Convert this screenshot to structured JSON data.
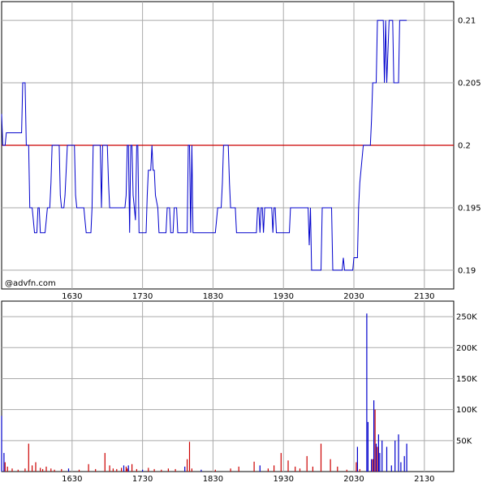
{
  "watermark": "@advfn.com",
  "colors": {
    "price": "#0000cc",
    "reference": "#cc0000",
    "volume_up": "#cc0000",
    "volume_down": "#0000cc",
    "grid": "#aaaaaa",
    "frame": "#000000"
  },
  "chart_data": [
    {
      "type": "line",
      "title": "",
      "xlabel": "",
      "ylabel": "",
      "x_ticks": [
        "1630",
        "1730",
        "1830",
        "1930",
        "2030",
        "2130"
      ],
      "y_ticks": [
        "0.19",
        "0.195",
        "0.2",
        "0.205",
        "0.21"
      ],
      "xlim": [
        "15:30",
        "21:55"
      ],
      "ylim": [
        0.1885,
        0.2115
      ],
      "grid": true,
      "reference_line": 0.2,
      "series": [
        {
          "points": [
            [
              "15:30",
              0.2025
            ],
            [
              "15:31",
              0.2
            ],
            [
              "15:33",
              0.2
            ],
            [
              "15:34",
              0.201
            ],
            [
              "15:40",
              0.201
            ],
            [
              "15:41",
              0.201
            ],
            [
              "15:47",
              0.201
            ],
            [
              "15:48",
              0.205
            ],
            [
              "15:50",
              0.205
            ],
            [
              "15:51",
              0.2
            ],
            [
              "15:53",
              0.2
            ],
            [
              "15:54",
              0.195
            ],
            [
              "15:56",
              0.195
            ],
            [
              "15:57",
              0.194
            ],
            [
              "15:58",
              0.193
            ],
            [
              "16:00",
              0.193
            ],
            [
              "16:01",
              0.195
            ],
            [
              "16:02",
              0.195
            ],
            [
              "16:03",
              0.193
            ],
            [
              "16:07",
              0.193
            ],
            [
              "16:08",
              0.194
            ],
            [
              "16:09",
              0.195
            ],
            [
              "16:11",
              0.195
            ],
            [
              "16:12",
              0.197
            ],
            [
              "16:13",
              0.2
            ],
            [
              "16:19",
              0.2
            ],
            [
              "16:20",
              0.196
            ],
            [
              "16:21",
              0.195
            ],
            [
              "16:23",
              0.195
            ],
            [
              "16:24",
              0.196
            ],
            [
              "16:26",
              0.2
            ],
            [
              "16:32",
              0.2
            ],
            [
              "16:33",
              0.196
            ],
            [
              "16:34",
              0.195
            ],
            [
              "16:40",
              0.195
            ],
            [
              "16:41",
              0.194
            ],
            [
              "16:42",
              0.193
            ],
            [
              "16:46",
              0.193
            ],
            [
              "16:47",
              0.195
            ],
            [
              "16:48",
              0.2
            ],
            [
              "16:54",
              0.2
            ],
            [
              "16:55",
              0.195
            ],
            [
              "16:56",
              0.2
            ],
            [
              "17:00",
              0.2
            ],
            [
              "17:01",
              0.197
            ],
            [
              "17:02",
              0.195
            ],
            [
              "17:15",
              0.195
            ],
            [
              "17:16",
              0.196
            ],
            [
              "17:17",
              0.2
            ],
            [
              "17:18",
              0.2
            ],
            [
              "17:19",
              0.193
            ],
            [
              "17:20",
              0.2
            ],
            [
              "17:21",
              0.2
            ],
            [
              "17:22",
              0.196
            ],
            [
              "17:23",
              0.195
            ],
            [
              "17:24",
              0.194
            ],
            [
              "17:25",
              0.2
            ],
            [
              "17:26",
              0.2
            ],
            [
              "17:27",
              0.193
            ],
            [
              "17:33",
              0.193
            ],
            [
              "17:34",
              0.196
            ],
            [
              "17:35",
              0.198
            ],
            [
              "17:37",
              0.198
            ],
            [
              "17:38",
              0.2
            ],
            [
              "17:39",
              0.198
            ],
            [
              "17:40",
              0.198
            ],
            [
              "17:41",
              0.196
            ],
            [
              "17:43",
              0.195
            ],
            [
              "17:44",
              0.193
            ],
            [
              "17:50",
              0.193
            ],
            [
              "17:51",
              0.195
            ],
            [
              "17:53",
              0.195
            ],
            [
              "17:54",
              0.193
            ],
            [
              "17:56",
              0.193
            ],
            [
              "17:57",
              0.195
            ],
            [
              "17:59",
              0.195
            ],
            [
              "18:00",
              0.193
            ],
            [
              "18:08",
              0.193
            ],
            [
              "18:09",
              0.2
            ],
            [
              "18:10",
              0.2
            ],
            [
              "18:11",
              0.193
            ],
            [
              "18:12",
              0.2
            ],
            [
              "18:13",
              0.193
            ],
            [
              "18:14",
              0.193
            ],
            [
              "18:15",
              0.193
            ],
            [
              "18:32",
              0.193
            ],
            [
              "18:33",
              0.194
            ],
            [
              "18:34",
              0.195
            ],
            [
              "18:37",
              0.195
            ],
            [
              "18:38",
              0.197
            ],
            [
              "18:39",
              0.2
            ],
            [
              "18:43",
              0.2
            ],
            [
              "18:44",
              0.197
            ],
            [
              "18:45",
              0.195
            ],
            [
              "18:49",
              0.195
            ],
            [
              "18:50",
              0.193
            ],
            [
              "18:53",
              0.193
            ],
            [
              "18:54",
              0.193
            ],
            [
              "19:07",
              0.193
            ],
            [
              "19:08",
              0.195
            ],
            [
              "19:09",
              0.195
            ],
            [
              "19:10",
              0.193
            ],
            [
              "19:11",
              0.195
            ],
            [
              "19:12",
              0.195
            ],
            [
              "19:13",
              0.193
            ],
            [
              "19:14",
              0.195
            ],
            [
              "19:20",
              0.195
            ],
            [
              "19:21",
              0.193
            ],
            [
              "19:22",
              0.195
            ],
            [
              "19:23",
              0.195
            ],
            [
              "19:24",
              0.193
            ],
            [
              "19:35",
              0.193
            ],
            [
              "19:36",
              0.195
            ],
            [
              "19:51",
              0.195
            ],
            [
              "19:52",
              0.192
            ],
            [
              "19:53",
              0.195
            ],
            [
              "19:54",
              0.19
            ],
            [
              "20:02",
              0.19
            ],
            [
              "20:03",
              0.195
            ],
            [
              "20:11",
              0.195
            ],
            [
              "20:12",
              0.19
            ],
            [
              "20:20",
              0.19
            ],
            [
              "20:21",
              0.191
            ],
            [
              "20:22",
              0.19
            ],
            [
              "20:29",
              0.19
            ],
            [
              "20:30",
              0.191
            ],
            [
              "20:33",
              0.191
            ],
            [
              "20:34",
              0.195
            ],
            [
              "20:35",
              0.197
            ],
            [
              "20:38",
              0.2
            ],
            [
              "20:44",
              0.2
            ],
            [
              "20:45",
              0.202
            ],
            [
              "20:46",
              0.205
            ],
            [
              "20:49",
              0.205
            ],
            [
              "20:50",
              0.21
            ],
            [
              "20:55",
              0.21
            ],
            [
              "20:56",
              0.205
            ],
            [
              "20:57",
              0.21
            ],
            [
              "20:58",
              0.205
            ],
            [
              "21:00",
              0.21
            ],
            [
              "21:03",
              0.21
            ],
            [
              "21:04",
              0.205
            ],
            [
              "21:08",
              0.205
            ],
            [
              "21:09",
              0.21
            ],
            [
              "21:15",
              0.21
            ]
          ]
        }
      ]
    },
    {
      "type": "bar",
      "title": "",
      "xlabel": "",
      "ylabel": "",
      "x_ticks": [
        "1630",
        "1730",
        "1830",
        "1930",
        "2030",
        "2130"
      ],
      "y_ticks": [
        "50K",
        "100K",
        "150K",
        "200K",
        "250K"
      ],
      "xlim": [
        "15:30",
        "21:55"
      ],
      "ylim": [
        0,
        275000
      ],
      "grid": true,
      "series": [
        {
          "bars": [
            [
              "15:30",
              90000,
              "down"
            ],
            [
              "15:32",
              30000,
              "down"
            ],
            [
              "15:33",
              15000,
              "up"
            ],
            [
              "15:35",
              8000,
              "up"
            ],
            [
              "15:39",
              5000,
              "up"
            ],
            [
              "15:44",
              3000,
              "up"
            ],
            [
              "15:50",
              5000,
              "up"
            ],
            [
              "15:53",
              45000,
              "up"
            ],
            [
              "15:56",
              10000,
              "up"
            ],
            [
              "15:59",
              15000,
              "up"
            ],
            [
              "16:03",
              6000,
              "up"
            ],
            [
              "16:05",
              4000,
              "up"
            ],
            [
              "16:08",
              8000,
              "up"
            ],
            [
              "16:12",
              5000,
              "up"
            ],
            [
              "16:15",
              3000,
              "up"
            ],
            [
              "16:21",
              4000,
              "up"
            ],
            [
              "16:27",
              5000,
              "down"
            ],
            [
              "16:36",
              3000,
              "up"
            ],
            [
              "16:44",
              12000,
              "up"
            ],
            [
              "16:50",
              4000,
              "up"
            ],
            [
              "16:58",
              30000,
              "up"
            ],
            [
              "17:02",
              10000,
              "up"
            ],
            [
              "17:05",
              5000,
              "up"
            ],
            [
              "17:08",
              4000,
              "up"
            ],
            [
              "17:12",
              6000,
              "up"
            ],
            [
              "17:14",
              10000,
              "down"
            ],
            [
              "17:16",
              8000,
              "up"
            ],
            [
              "17:17",
              5000,
              "up"
            ],
            [
              "17:18",
              10000,
              "down"
            ],
            [
              "17:21",
              12000,
              "up"
            ],
            [
              "17:25",
              4000,
              "up"
            ],
            [
              "17:30",
              3000,
              "down"
            ],
            [
              "17:35",
              6000,
              "up"
            ],
            [
              "17:40",
              4000,
              "up"
            ],
            [
              "17:46",
              3000,
              "up"
            ],
            [
              "17:52",
              5000,
              "up"
            ],
            [
              "17:58",
              4000,
              "up"
            ],
            [
              "18:06",
              8000,
              "down"
            ],
            [
              "18:08",
              20000,
              "up"
            ],
            [
              "18:10",
              48000,
              "up"
            ],
            [
              "18:12",
              5000,
              "up"
            ],
            [
              "18:20",
              3000,
              "down"
            ],
            [
              "18:32",
              3000,
              "up"
            ],
            [
              "18:45",
              5000,
              "up"
            ],
            [
              "18:52",
              8000,
              "up"
            ],
            [
              "19:05",
              16000,
              "up"
            ],
            [
              "19:10",
              10000,
              "down"
            ],
            [
              "19:17",
              5000,
              "up"
            ],
            [
              "19:22",
              10000,
              "up"
            ],
            [
              "19:28",
              30000,
              "up"
            ],
            [
              "19:34",
              18000,
              "up"
            ],
            [
              "19:40",
              8000,
              "up"
            ],
            [
              "19:44",
              5000,
              "up"
            ],
            [
              "19:50",
              25000,
              "up"
            ],
            [
              "19:55",
              8000,
              "up"
            ],
            [
              "20:02",
              45000,
              "up"
            ],
            [
              "20:10",
              20000,
              "up"
            ],
            [
              "20:16",
              8000,
              "up"
            ],
            [
              "20:24",
              3000,
              "up"
            ],
            [
              "20:32",
              15000,
              "up"
            ],
            [
              "20:33",
              40000,
              "down"
            ],
            [
              "20:35",
              4000,
              "up"
            ],
            [
              "20:41",
              255000,
              "down"
            ],
            [
              "20:42",
              80000,
              "down"
            ],
            [
              "20:45",
              20000,
              "down"
            ],
            [
              "20:46",
              20000,
              "up"
            ],
            [
              "20:47",
              115000,
              "down"
            ],
            [
              "20:48",
              100000,
              "up"
            ],
            [
              "20:49",
              45000,
              "down"
            ],
            [
              "20:50",
              40000,
              "up"
            ],
            [
              "20:51",
              60000,
              "down"
            ],
            [
              "20:52",
              30000,
              "down"
            ],
            [
              "20:54",
              50000,
              "down"
            ],
            [
              "20:58",
              40000,
              "down"
            ],
            [
              "21:02",
              10000,
              "down"
            ],
            [
              "21:05",
              50000,
              "down"
            ],
            [
              "21:08",
              60000,
              "down"
            ],
            [
              "21:10",
              15000,
              "down"
            ],
            [
              "21:13",
              25000,
              "down"
            ],
            [
              "21:15",
              45000,
              "down"
            ]
          ]
        }
      ]
    }
  ]
}
